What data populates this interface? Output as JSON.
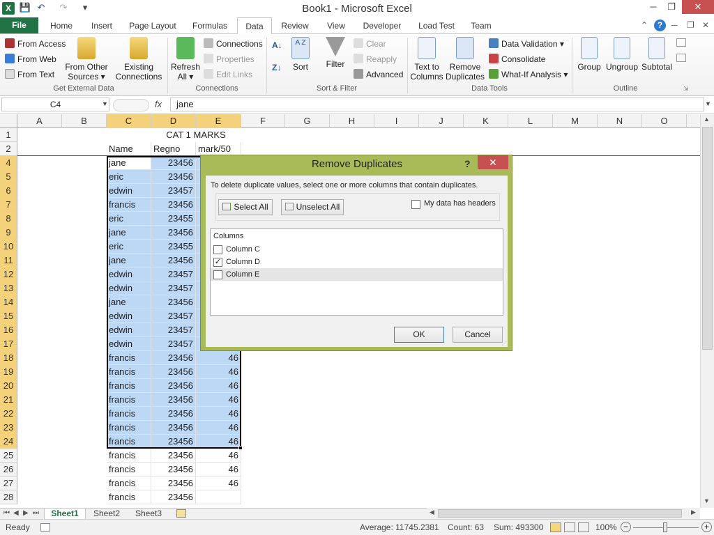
{
  "window": {
    "title": "Book1 - Microsoft Excel"
  },
  "quick_access": {
    "save": "💾",
    "undo": "↶",
    "redo": "↷",
    "more": "▾"
  },
  "tabs": [
    "Home",
    "Insert",
    "Page Layout",
    "Formulas",
    "Data",
    "Review",
    "View",
    "Developer",
    "Load Test",
    "Team"
  ],
  "file_tab": "File",
  "ribbon": {
    "get_external": {
      "access": "From Access",
      "web": "From Web",
      "text": "From Text",
      "other1": "From Other",
      "other2": "Sources ▾",
      "existing1": "Existing",
      "existing2": "Connections",
      "group": "Get External Data"
    },
    "connections": {
      "refresh1": "Refresh",
      "refresh2": "All ▾",
      "connections": "Connections",
      "properties": "Properties",
      "edit_links": "Edit Links",
      "group": "Connections"
    },
    "sort_filter": {
      "sort": "Sort",
      "filter": "Filter",
      "clear": "Clear",
      "reapply": "Reapply",
      "advanced": "Advanced",
      "group": "Sort & Filter"
    },
    "data_tools": {
      "ttc1": "Text to",
      "ttc2": "Columns",
      "rd1": "Remove",
      "rd2": "Duplicates",
      "validation": "Data Validation ▾",
      "consolidate": "Consolidate",
      "whatif": "What-If Analysis ▾",
      "group": "Data Tools"
    },
    "outline": {
      "group_btn": "Group",
      "ungroup": "Ungroup",
      "subtotal": "Subtotal",
      "group": "Outline"
    }
  },
  "formula_bar": {
    "name_box": "C4",
    "fx": "fx",
    "value": "jane"
  },
  "columns": [
    "A",
    "B",
    "C",
    "D",
    "E",
    "F",
    "G",
    "H",
    "I",
    "J",
    "K",
    "L",
    "M",
    "N",
    "O"
  ],
  "sheet_title": "CAT 1 MARKS",
  "headers": {
    "c": "Name",
    "d": "Regno",
    "e": "mark/50"
  },
  "rows": [
    {
      "n": "4",
      "c": "jane",
      "d": "23456",
      "e": ""
    },
    {
      "n": "5",
      "c": "eric",
      "d": "23456",
      "e": ""
    },
    {
      "n": "6",
      "c": "edwin",
      "d": "23457",
      "e": ""
    },
    {
      "n": "7",
      "c": "francis",
      "d": "23456",
      "e": ""
    },
    {
      "n": "8",
      "c": "eric",
      "d": "23455",
      "e": ""
    },
    {
      "n": "9",
      "c": "jane",
      "d": "23456",
      "e": ""
    },
    {
      "n": "10",
      "c": "eric",
      "d": "23455",
      "e": ""
    },
    {
      "n": "11",
      "c": "jane",
      "d": "23456",
      "e": ""
    },
    {
      "n": "12",
      "c": "edwin",
      "d": "23457",
      "e": ""
    },
    {
      "n": "13",
      "c": "edwin",
      "d": "23457",
      "e": ""
    },
    {
      "n": "14",
      "c": "jane",
      "d": "23456",
      "e": ""
    },
    {
      "n": "15",
      "c": "edwin",
      "d": "23457",
      "e": ""
    },
    {
      "n": "16",
      "c": "edwin",
      "d": "23457",
      "e": ""
    },
    {
      "n": "17",
      "c": "edwin",
      "d": "23457",
      "e": ""
    },
    {
      "n": "18",
      "c": "francis",
      "d": "23456",
      "e": "46"
    },
    {
      "n": "19",
      "c": "francis",
      "d": "23456",
      "e": "46"
    },
    {
      "n": "20",
      "c": "francis",
      "d": "23456",
      "e": "46"
    },
    {
      "n": "21",
      "c": "francis",
      "d": "23456",
      "e": "46"
    },
    {
      "n": "22",
      "c": "francis",
      "d": "23456",
      "e": "46"
    },
    {
      "n": "23",
      "c": "francis",
      "d": "23456",
      "e": "46"
    },
    {
      "n": "24",
      "c": "francis",
      "d": "23456",
      "e": "46"
    },
    {
      "n": "25",
      "c": "francis",
      "d": "23456",
      "e": "46"
    },
    {
      "n": "26",
      "c": "francis",
      "d": "23456",
      "e": "46"
    },
    {
      "n": "27",
      "c": "francis",
      "d": "23456",
      "e": "46"
    },
    {
      "n": "28",
      "c": "francis",
      "d": "23456",
      "e": ""
    }
  ],
  "sheets": [
    "Sheet1",
    "Sheet2",
    "Sheet3"
  ],
  "status": {
    "ready": "Ready",
    "average": "Average: 11745.2381",
    "count": "Count: 63",
    "sum": "Sum: 493300",
    "zoom": "100%"
  },
  "dialog": {
    "title": "Remove Duplicates",
    "help": "?",
    "close": "✕",
    "instruction": "To delete duplicate values, select one or more columns that contain duplicates.",
    "select_all": "Select All",
    "unselect_all": "Unselect All",
    "headers_label": "My data has headers",
    "columns_header": "Columns",
    "columns": [
      {
        "label": "Column C",
        "checked": false
      },
      {
        "label": "Column D",
        "checked": true
      },
      {
        "label": "Column E",
        "checked": false
      }
    ],
    "ok": "OK",
    "cancel": "Cancel"
  }
}
